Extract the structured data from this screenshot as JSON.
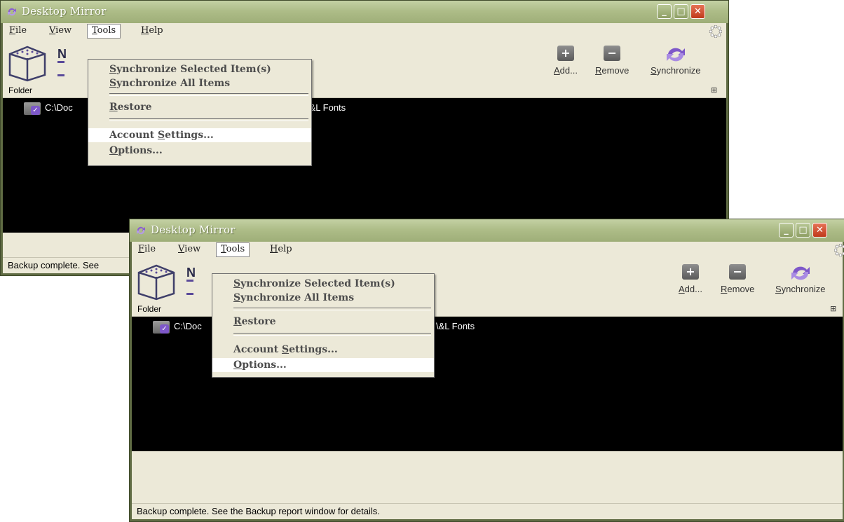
{
  "app_title": "Desktop Mirror",
  "menus": [
    {
      "prefix": "",
      "mnemonic": "F",
      "rest": "ile"
    },
    {
      "prefix": "",
      "mnemonic": "V",
      "rest": "iew"
    },
    {
      "prefix": "",
      "mnemonic": "T",
      "rest": "ools"
    },
    {
      "prefix": "",
      "mnemonic": "H",
      "rest": "elp"
    }
  ],
  "tools_menu": [
    {
      "prefix": "",
      "mnemonic": "S",
      "rest": "ynchronize Selected Item(s)"
    },
    {
      "prefix": "",
      "mnemonic": "S",
      "rest": "ynchronize All Items"
    },
    {
      "prefix": "",
      "mnemonic": "R",
      "rest": "estore"
    },
    {
      "prefix": "Account ",
      "mnemonic": "S",
      "rest": "ettings..."
    },
    {
      "prefix": "",
      "mnemonic": "O",
      "rest": "ptions..."
    }
  ],
  "toolbar": {
    "add": {
      "mnemonic": "A",
      "rest": "dd..."
    },
    "remove": {
      "mnemonic": "R",
      "rest": "emove"
    },
    "sync": {
      "mnemonic": "S",
      "rest": "ynchronize"
    },
    "logo_letter": "N"
  },
  "list": {
    "column_folder": "Folder",
    "row_path_start": "C:\\Doc",
    "row_path_end": "\\&L Fonts"
  },
  "status": {
    "text_short": "Backup complete.  See",
    "text_full": "Backup complete.  See the Backup report window for details."
  },
  "colors": {
    "title_bar": "#aebd88",
    "frame": "#606c44",
    "accent_purple": "#7e58c9",
    "close_button": "#c0391b",
    "list_background": "#000000"
  },
  "icons": {
    "app": "sync-arrows-icon",
    "add": "plus-icon",
    "remove": "minus-icon",
    "sync": "sync-arrows-icon",
    "column_chooser": "column-chooser-icon",
    "folder": "folder-check-icon",
    "activity": "spinner-icon"
  }
}
